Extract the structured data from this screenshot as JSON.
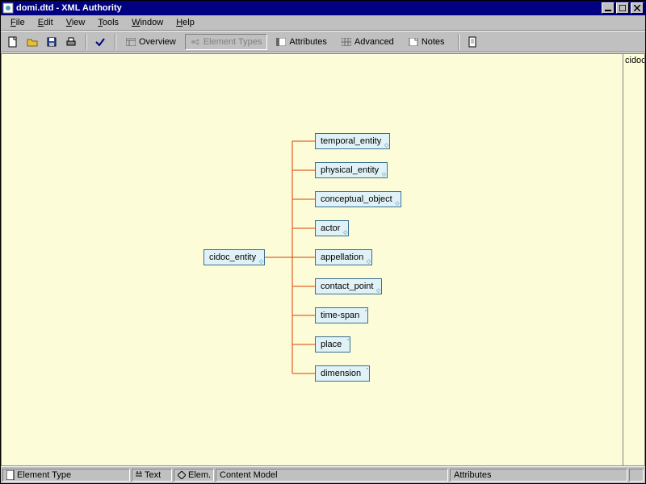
{
  "title": "domi.dtd - XML Authority",
  "menus": [
    "File",
    "Edit",
    "View",
    "Tools",
    "Window",
    "Help"
  ],
  "tabs": {
    "overview": "Overview",
    "element_types": "Element Types",
    "attributes": "Attributes",
    "advanced": "Advanced",
    "notes": "Notes"
  },
  "root_node": "cidoc_entity",
  "children": [
    {
      "label": "temporal_entity",
      "handle": "diamond"
    },
    {
      "label": "physical_entity",
      "handle": "diamond"
    },
    {
      "label": "conceptual_object",
      "handle": "diamond"
    },
    {
      "label": "actor",
      "handle": "diamond"
    },
    {
      "label": "appellation",
      "handle": "diamond"
    },
    {
      "label": "contact_point",
      "handle": "diamond"
    },
    {
      "label": "time-span",
      "handle": "top"
    },
    {
      "label": "place",
      "handle": "top"
    },
    {
      "label": "dimension",
      "handle": "top"
    }
  ],
  "side_label": "cidoc",
  "status": {
    "element_type": "Element Type",
    "text": "Text",
    "elem": "Elem.",
    "content_model": "Content Model",
    "attributes": "Attributes"
  }
}
